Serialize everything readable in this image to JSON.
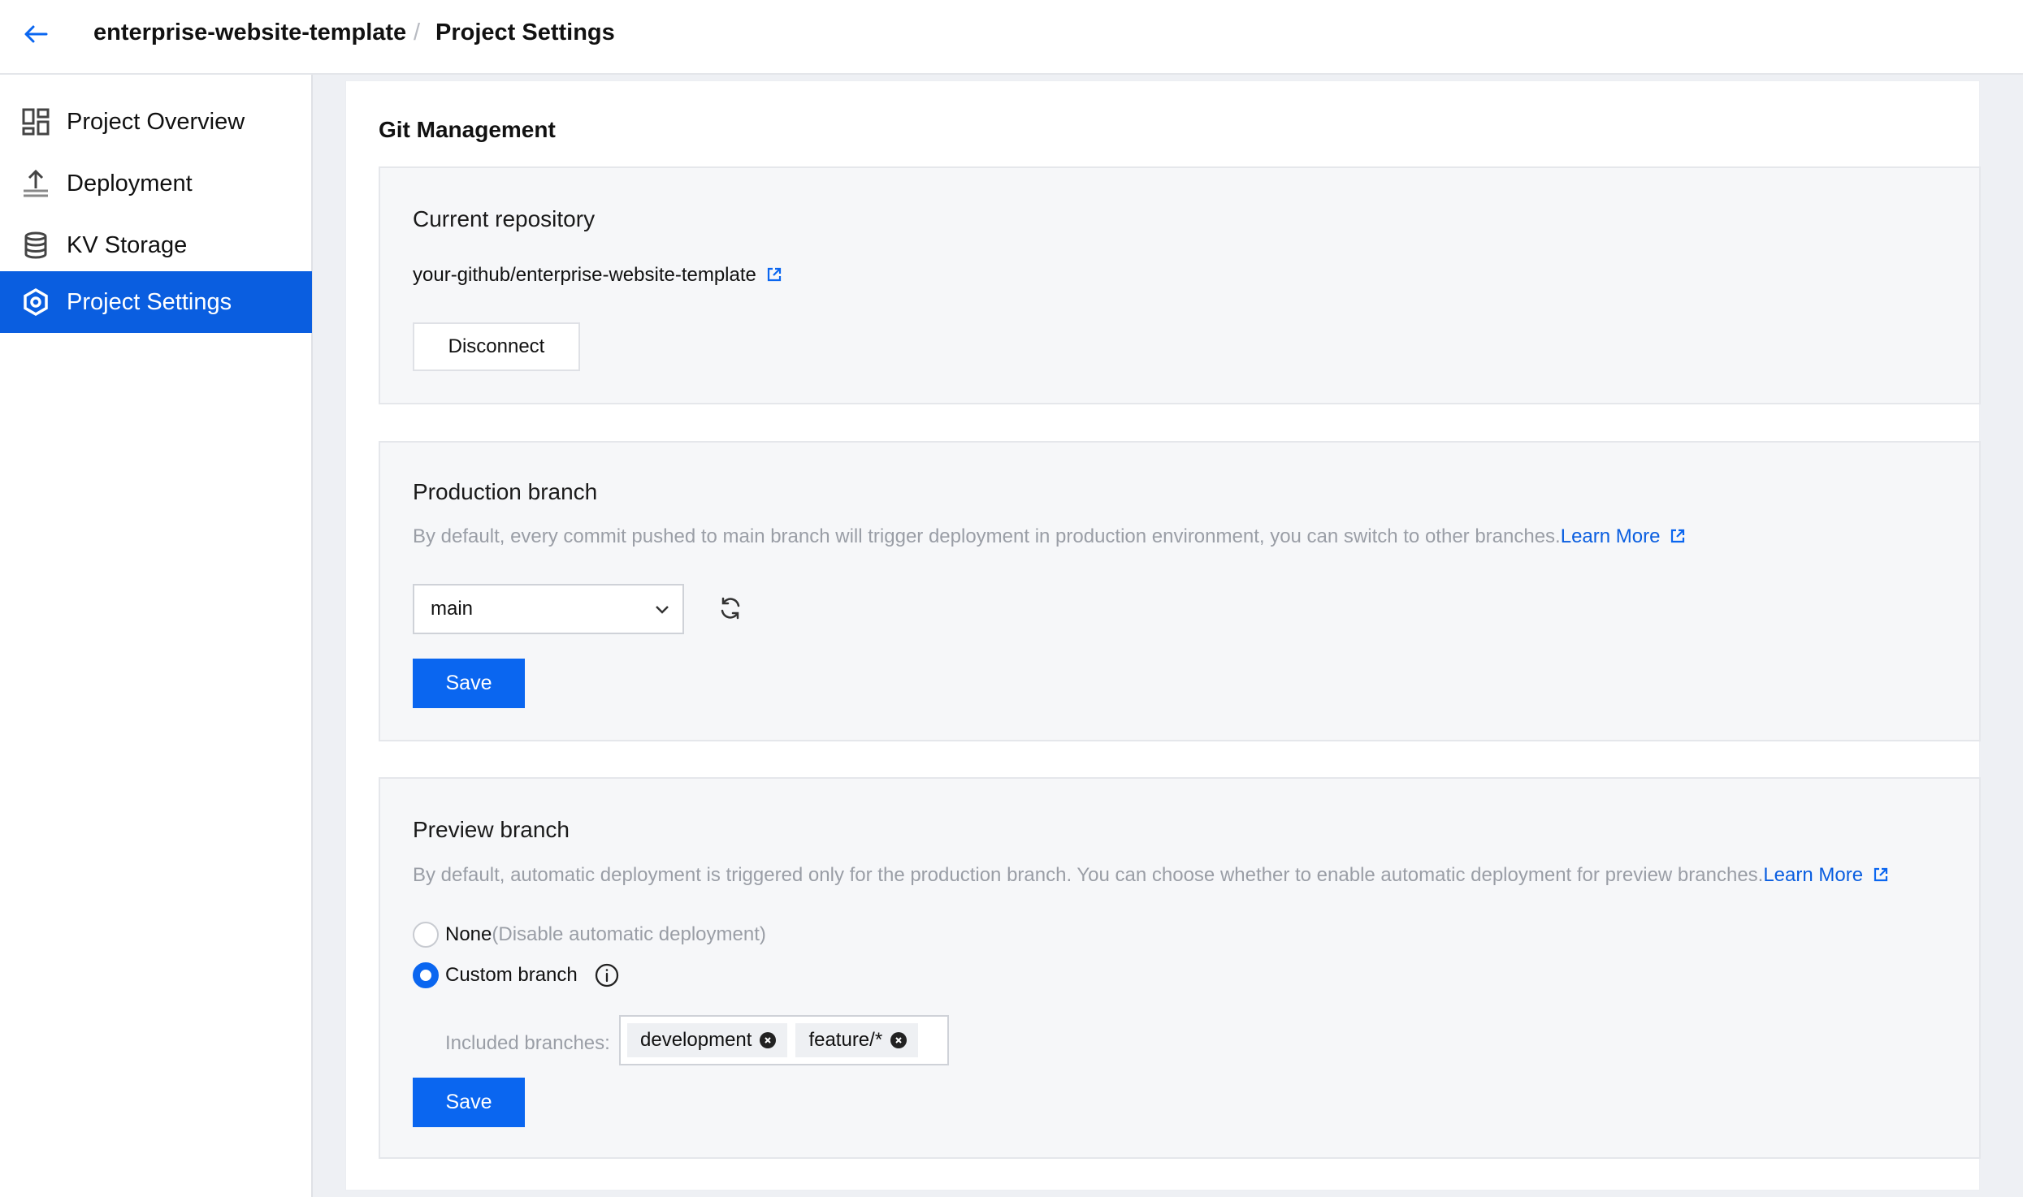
{
  "header": {
    "project_name": "enterprise-website-template",
    "separator": "/",
    "current_page": "Project Settings"
  },
  "sidebar": {
    "items": [
      {
        "label": "Project Overview",
        "icon": "dashboard-icon",
        "active": false
      },
      {
        "label": "Deployment",
        "icon": "upload-icon",
        "active": false
      },
      {
        "label": "KV Storage",
        "icon": "database-icon",
        "active": false
      },
      {
        "label": "Project Settings",
        "icon": "settings-hex-icon",
        "active": true
      }
    ]
  },
  "main": {
    "title": "Git Management",
    "repository": {
      "title": "Current repository",
      "repo": "your-github/enterprise-website-template",
      "disconnect_label": "Disconnect"
    },
    "production": {
      "title": "Production branch",
      "description": "By default, every commit pushed to main branch will trigger deployment in production environment, you can switch to other branches.",
      "learn_more": "Learn More",
      "selected_branch": "main",
      "save_label": "Save"
    },
    "preview": {
      "title": "Preview branch",
      "description": "By default, automatic deployment is triggered only for the production branch. You can choose whether to enable automatic deployment for preview branches.",
      "learn_more": "Learn More",
      "option_none": "None",
      "option_none_hint": "(Disable automatic deployment)",
      "option_custom": "Custom branch",
      "selected_option": "custom",
      "included_label": "Included branches:",
      "branches": [
        "development",
        "feature/*"
      ],
      "save_label": "Save"
    }
  },
  "colors": {
    "accent": "#0a66f0",
    "active_nav": "#0a5ee0",
    "muted_text": "#9a9ea6",
    "section_bg": "#f6f7f9"
  }
}
